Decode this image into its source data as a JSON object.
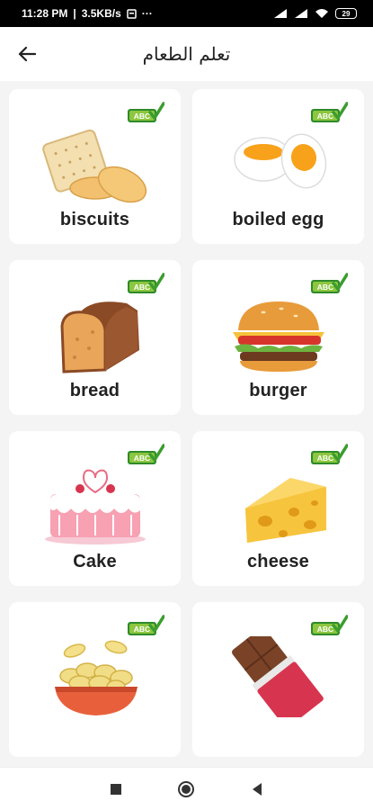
{
  "status": {
    "time": "11:28 PM",
    "speed": "3.5KB/s",
    "more": "···",
    "battery": "29"
  },
  "header": {
    "title": "تعلم الطعام"
  },
  "badge_text": "ABC",
  "colors": {
    "badge_green": "#8dc63f",
    "check_green": "#3a9d2e"
  },
  "items": [
    {
      "label": "biscuits",
      "icon": "biscuits-image"
    },
    {
      "label": "boiled egg",
      "icon": "boiled-egg-image"
    },
    {
      "label": "bread",
      "icon": "bread-image"
    },
    {
      "label": "burger",
      "icon": "burger-image"
    },
    {
      "label": "Cake",
      "icon": "cake-image"
    },
    {
      "label": "cheese",
      "icon": "cheese-image"
    },
    {
      "label": "",
      "icon": "chips-image"
    },
    {
      "label": "",
      "icon": "chocolate-image"
    }
  ]
}
